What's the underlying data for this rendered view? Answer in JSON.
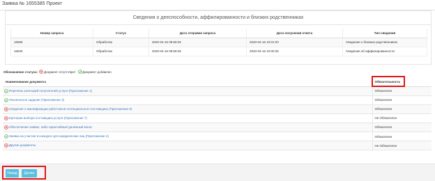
{
  "page": {
    "title": "Заявка № 1655385 Проект"
  },
  "panel": {
    "title": "Сведения о дееспособности, аффилированности и близких родственниках"
  },
  "requests_table": {
    "headers": [
      "Номер запроса",
      "Статус",
      "Дата отправки запроса",
      "Дата получения ответа",
      "Тип сведения"
    ],
    "rows": [
      [
        "16596",
        "Обработан",
        "2020-04-16 09:59:25",
        "2020-04-16 10:01:03",
        "Сведения о близких родственниках"
      ],
      [
        "16630",
        "Обработан",
        "2020-04-16 09:59:25",
        "2020-04-16 10:00:25",
        "Сведения об аффилированности"
      ]
    ]
  },
  "legend": {
    "label": "Обозначение статуса:",
    "missing": "Документ отсутствует",
    "added": "Документ добавлен"
  },
  "documents_table": {
    "header_name": "Наименование документа",
    "header_required": "Обязательность",
    "rows": [
      {
        "name": "Перечень категорий получателей услуги (Приложение 1)",
        "status": "added",
        "required": "Обязателен"
      },
      {
        "name": "Техническое задание (Приложение 3)",
        "status": "added",
        "required": "Обязателен"
      },
      {
        "name": "Сведения о квалификации работников потенциального поставщика (Приложение 6)",
        "status": "missing",
        "required": "Обязателен"
      },
      {
        "name": "Критерии выбора поставщика услуги (Приложение 7)",
        "status": "missing",
        "required": "Не Обязателен"
      },
      {
        "name": "Обеспечение заявки, либо гарантийный денежный взнос",
        "status": "missing",
        "required": "Обязателен"
      },
      {
        "name": "Заявка на участие в конкурсе для юридических лиц (Приложение 4)",
        "status": "added",
        "required": "Обязателен"
      },
      {
        "name": "Другие документы",
        "status": "missing",
        "required": "Не Обязателен"
      }
    ]
  },
  "buttons": {
    "back": "Назад",
    "next": "Далее"
  },
  "colors": {
    "status_missing": "#d9534f",
    "status_added": "#5cb85c",
    "link": "#3c76c0",
    "button": "#5bc0de",
    "highlight": "#e01515"
  }
}
